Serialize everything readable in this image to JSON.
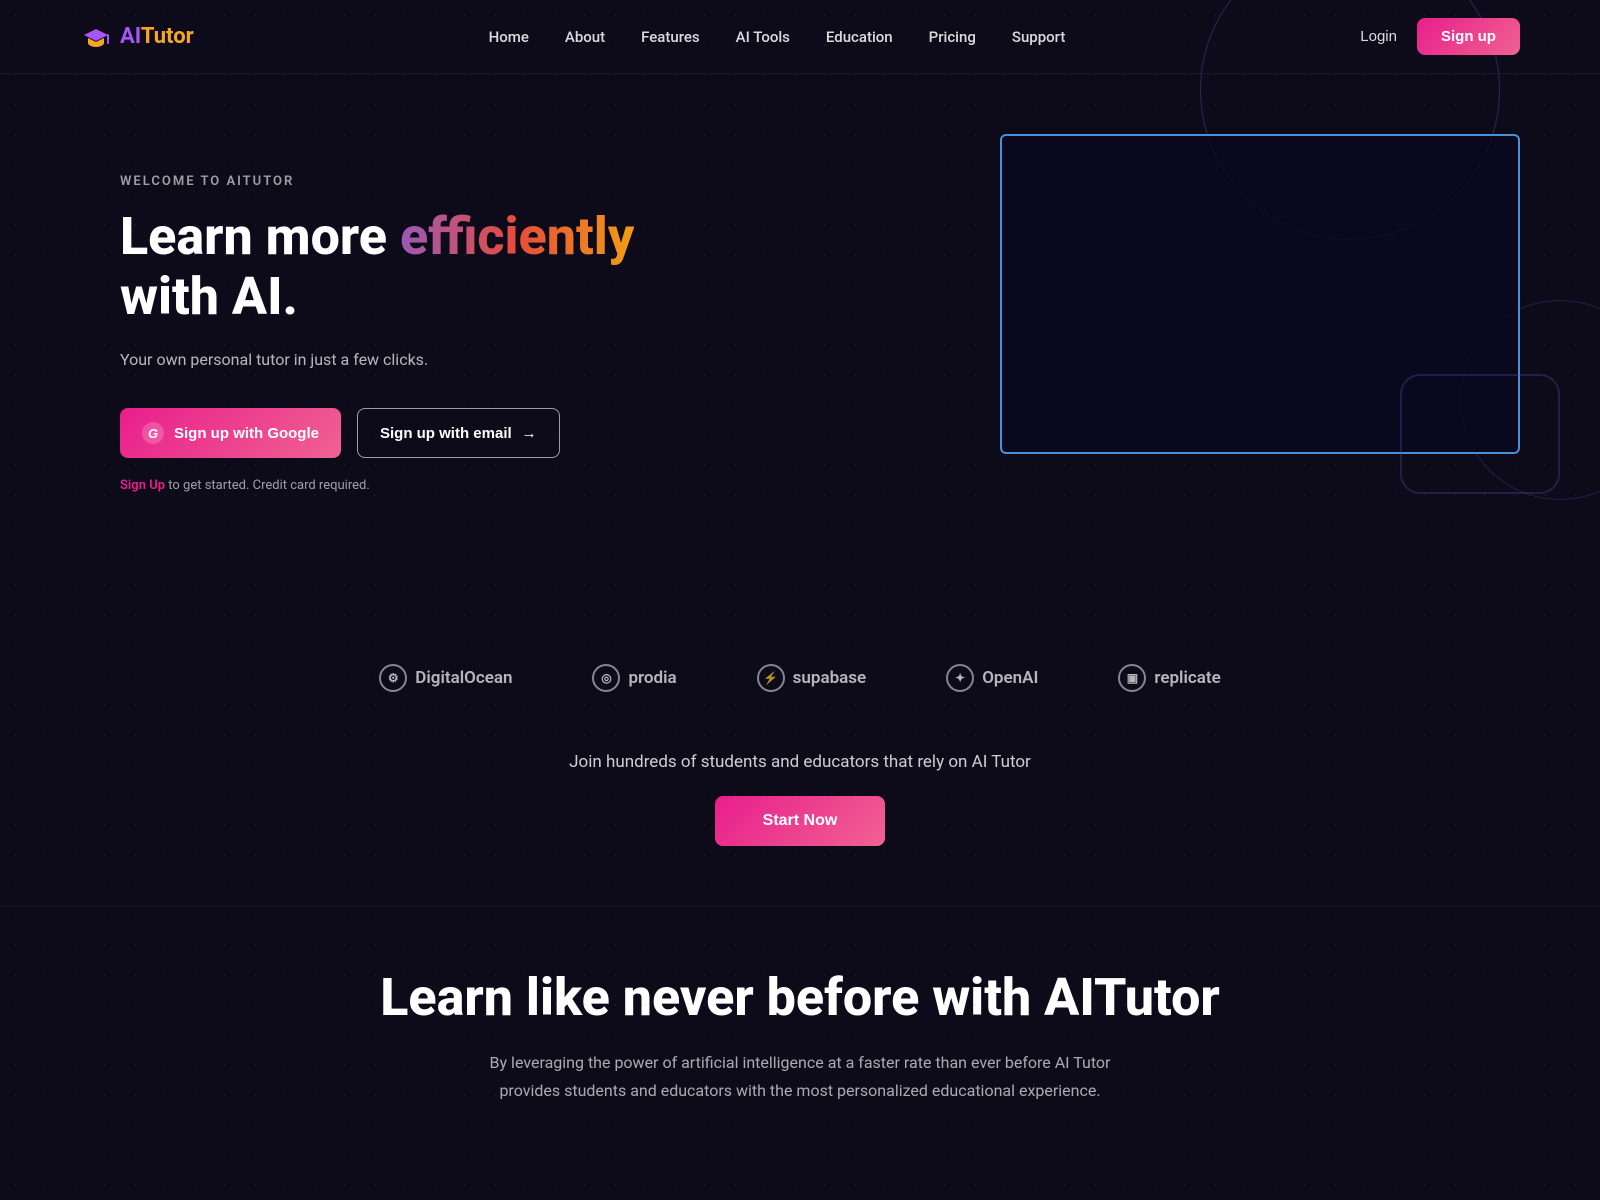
{
  "brand": {
    "logo_ai": "AI",
    "logo_tutor": "Tutor",
    "full_name": "AITutor"
  },
  "nav": {
    "links": [
      {
        "label": "Home",
        "id": "home"
      },
      {
        "label": "About",
        "id": "about"
      },
      {
        "label": "Features",
        "id": "features"
      },
      {
        "label": "AI Tools",
        "id": "ai-tools"
      },
      {
        "label": "Education",
        "id": "education"
      },
      {
        "label": "Pricing",
        "id": "pricing"
      },
      {
        "label": "Support",
        "id": "support"
      }
    ],
    "login_label": "Login",
    "signup_label": "Sign up"
  },
  "hero": {
    "subtitle": "WELCOME TO AITUTOR",
    "title_start": "Learn more ",
    "title_highlight": "efficiently",
    "title_end": " with AI.",
    "description": "Your own personal tutor in just a few clicks.",
    "btn_google": "Sign up with Google",
    "btn_email": "Sign up with email",
    "note_link": "Sign Up",
    "note_text": " to get started. Credit card required."
  },
  "partners": [
    {
      "label": "DigitalOcean",
      "icon": "⚙"
    },
    {
      "label": "prodia",
      "icon": "◎"
    },
    {
      "label": "supabase",
      "icon": "⚡"
    },
    {
      "label": "OpenAI",
      "icon": "✦"
    },
    {
      "label": "replicate",
      "icon": "▣"
    }
  ],
  "cta": {
    "text": "Join hundreds of students and educators that rely on AI Tutor",
    "button_label": "Start Now"
  },
  "learn_section": {
    "title": "Learn like never before with AITutor",
    "description": "By leveraging the power of artificial intelligence at a faster rate than ever before AI Tutor provides students and educators with the most personalized educational experience."
  }
}
